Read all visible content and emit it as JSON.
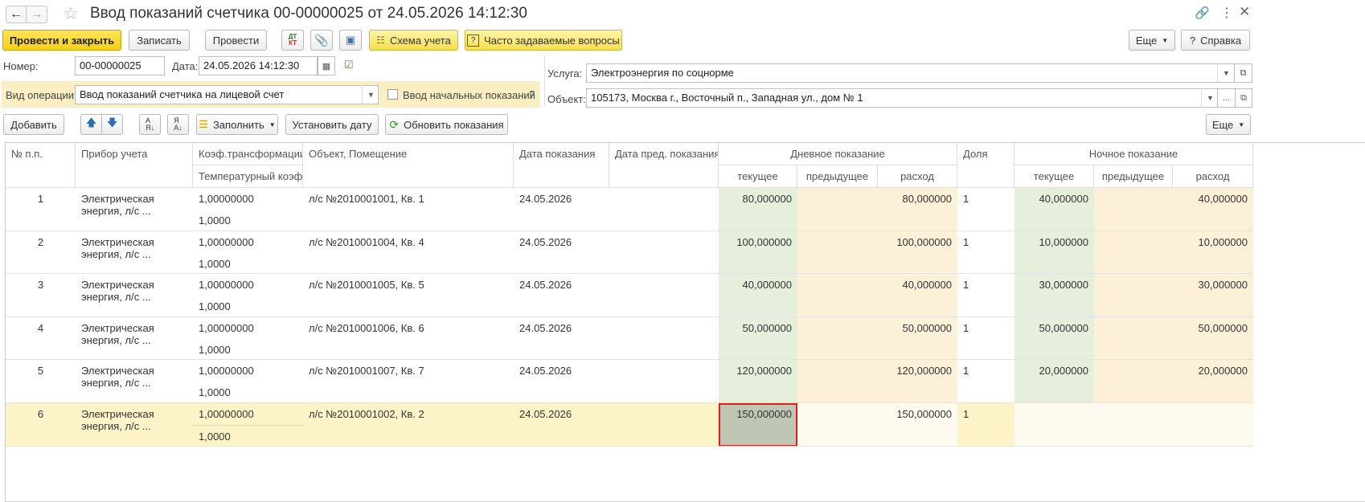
{
  "title": "Ввод показаний счетчика 00-00000025 от 24.05.2026 14:12:30",
  "toolbar": {
    "post_close": "Провести и закрыть",
    "write": "Записать",
    "post": "Провести",
    "scheme": "Схема учета",
    "faq": "Часто задаваемые вопросы",
    "more": "Еще",
    "help": "Справка"
  },
  "form": {
    "number_label": "Номер:",
    "number_value": "00-00000025",
    "date_label": "Дата:",
    "date_value": "24.05.2026 14:12:30",
    "op_label": "Вид операции:",
    "op_value": "Ввод показаний счетчика на лицевой счет",
    "initial_label": "Ввод начальных показаний",
    "service_label": "Услуга:",
    "service_value": "Электроэнергия по соцнорме",
    "object_label": "Объект:",
    "object_value": "105173, Москва г., Восточный п., Западная ул., дом № 1"
  },
  "table_toolbar": {
    "add": "Добавить",
    "fill": "Заполнить",
    "set_date": "Установить дату",
    "refresh": "Обновить показания",
    "more": "Еще"
  },
  "columns": {
    "num": "№ п.п.",
    "device": "Прибор учета",
    "coef": "Коэф.трансформации",
    "temp": "Температурный коэф.",
    "object": "Объект, Помещение",
    "date": "Дата показания",
    "prev_date": "Дата пред. показания",
    "day": "Дневное показание",
    "current": "текущее",
    "previous": "предыдущее",
    "usage": "расход",
    "share": "Доля",
    "night": "Ночное показание"
  },
  "rows": [
    {
      "num": "1",
      "device": "Электрическая энергия, л/с ...",
      "coef": "1,00000000",
      "temp": "1,0000",
      "object": "л/с №2010001001, Кв. 1",
      "date": "24.05.2026",
      "prev_date": "",
      "day_cur": "80,000000",
      "day_prev": "",
      "day_use": "80,000000",
      "share": "1",
      "night_cur": "40,000000",
      "night_prev": "",
      "night_use": "40,000000"
    },
    {
      "num": "2",
      "device": "Электрическая энергия, л/с ...",
      "coef": "1,00000000",
      "temp": "1,0000",
      "object": "л/с №2010001004, Кв. 4",
      "date": "24.05.2026",
      "prev_date": "",
      "day_cur": "100,000000",
      "day_prev": "",
      "day_use": "100,000000",
      "share": "1",
      "night_cur": "10,000000",
      "night_prev": "",
      "night_use": "10,000000"
    },
    {
      "num": "3",
      "device": "Электрическая энергия, л/с ...",
      "coef": "1,00000000",
      "temp": "1,0000",
      "object": "л/с №2010001005, Кв. 5",
      "date": "24.05.2026",
      "prev_date": "",
      "day_cur": "40,000000",
      "day_prev": "",
      "day_use": "40,000000",
      "share": "1",
      "night_cur": "30,000000",
      "night_prev": "",
      "night_use": "30,000000"
    },
    {
      "num": "4",
      "device": "Электрическая энергия, л/с ...",
      "coef": "1,00000000",
      "temp": "1,0000",
      "object": "л/с №2010001006, Кв. 6",
      "date": "24.05.2026",
      "prev_date": "",
      "day_cur": "50,000000",
      "day_prev": "",
      "day_use": "50,000000",
      "share": "1",
      "night_cur": "50,000000",
      "night_prev": "",
      "night_use": "50,000000"
    },
    {
      "num": "5",
      "device": "Электрическая энергия, л/с ...",
      "coef": "1,00000000",
      "temp": "1,0000",
      "object": "л/с №2010001007, Кв. 7",
      "date": "24.05.2026",
      "prev_date": "",
      "day_cur": "120,000000",
      "day_prev": "",
      "day_use": "120,000000",
      "share": "1",
      "night_cur": "20,000000",
      "night_prev": "",
      "night_use": "20,000000"
    },
    {
      "num": "6",
      "device": "Электрическая энергия, л/с ...",
      "coef": "1,00000000",
      "temp": "1,0000",
      "object": "л/с №2010001002, Кв. 2",
      "date": "24.05.2026",
      "prev_date": "",
      "day_cur": "150,000000",
      "day_prev": "",
      "day_use": "150,000000",
      "share": "1",
      "night_cur": "",
      "night_prev": "",
      "night_use": ""
    }
  ],
  "colors": {
    "primary": "#f5cf17",
    "day_current_bg": "#e5efdc",
    "usage_bg": "#fdf0d8",
    "selected_row_bg": "#fdf3c8",
    "focus_border": "#e21b1b"
  }
}
